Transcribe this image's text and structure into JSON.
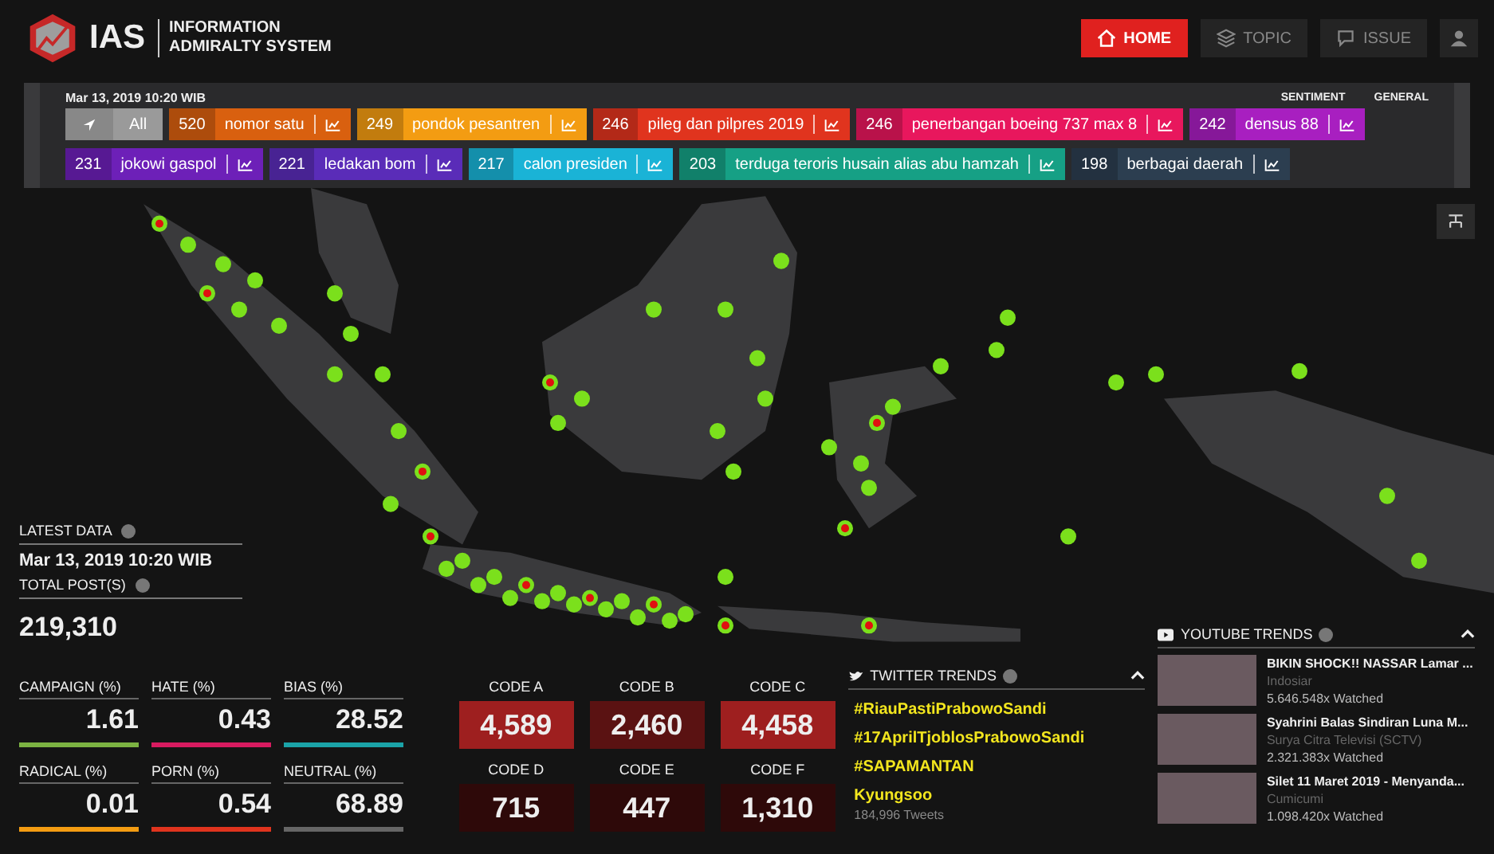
{
  "brand": {
    "short": "IAS",
    "line1": "INFORMATION",
    "line2": "ADMIRALTY SYSTEM"
  },
  "nav": [
    {
      "label": "HOME",
      "kind": "home",
      "selected": true
    },
    {
      "label": "TOPIC",
      "kind": "topic",
      "selected": false
    },
    {
      "label": "ISSUE",
      "kind": "issue",
      "selected": false
    },
    {
      "kind": "user",
      "selected": false
    }
  ],
  "filter_bar": {
    "date": "Mar 13, 2019 10:20 WIB",
    "sentiment": "SENTIMENT",
    "general": "GENERAL",
    "all": "All",
    "topics": [
      {
        "count": "520",
        "label": "nomor satu",
        "color": "#d9600f"
      },
      {
        "count": "249",
        "label": "pondok pesantren",
        "color": "#f39c12"
      },
      {
        "count": "246",
        "label": "pileg dan pilpres 2019",
        "color": "#e0341e"
      },
      {
        "count": "246",
        "label": "penerbangan boeing 737 max 8",
        "color": "#e8175d"
      },
      {
        "count": "242",
        "label": "densus 88",
        "color": "#a81fc0"
      },
      {
        "count": "231",
        "label": "jokowi gaspol",
        "color": "#6d20b8"
      },
      {
        "count": "221",
        "label": "ledakan bom",
        "color": "#5a2cb8"
      },
      {
        "count": "217",
        "label": "calon presiden",
        "color": "#1ab3d6"
      },
      {
        "count": "203",
        "label": "terduga teroris husain alias abu hamzah",
        "color": "#16a085"
      },
      {
        "count": "198",
        "label": "berbagai daerah",
        "color": "#2c3e50"
      }
    ]
  },
  "summary": {
    "latest_label": "LATEST DATA",
    "latest_value": "Mar 13, 2019 10:20 WIB",
    "total_label": "TOTAL POST(S)",
    "total_value": "219,310"
  },
  "metrics": [
    {
      "label": "CAMPAIGN (%)",
      "value": "1.61",
      "color": "#7cb342"
    },
    {
      "label": "HATE (%)",
      "value": "0.43",
      "color": "#d81b60"
    },
    {
      "label": "BIAS (%)",
      "value": "28.52",
      "color": "#1ba3a8"
    },
    {
      "label": "RADICAL (%)",
      "value": "0.01",
      "color": "#f39c12"
    },
    {
      "label": "PORN (%)",
      "value": "0.54",
      "color": "#e0341e"
    },
    {
      "label": "NEUTRAL (%)",
      "value": "68.89",
      "color": "#666666"
    }
  ],
  "codes": [
    {
      "label": "CODE A",
      "value": "4,589",
      "color": "#9e1f1f"
    },
    {
      "label": "CODE B",
      "value": "2,460",
      "color": "#5a1212"
    },
    {
      "label": "CODE C",
      "value": "4,458",
      "color": "#9e1f1f"
    },
    {
      "label": "CODE D",
      "value": "715",
      "color": "#2e0909"
    },
    {
      "label": "CODE E",
      "value": "447",
      "color": "#2e0909"
    },
    {
      "label": "CODE F",
      "value": "1,310",
      "color": "#2e0909"
    }
  ],
  "twitter": {
    "title": "TWITTER TRENDS",
    "trends": [
      {
        "tag": "#RiauPastiPrabowoSandi"
      },
      {
        "tag": "#17AprilTjoblosPrabowoSandi"
      },
      {
        "tag": "#SAPAMANTAN"
      },
      {
        "tag": "Kyungsoo",
        "count": "184,996 Tweets"
      }
    ]
  },
  "youtube": {
    "title": "YOUTUBE TRENDS",
    "videos": [
      {
        "title": "BIKIN SHOCK!! NASSAR Lamar ...",
        "channel": "Indosiar",
        "views": "5.646.548x Watched"
      },
      {
        "title": "Syahrini Balas Sindiran Luna M...",
        "channel": "Surya Citra Televisi (SCTV)",
        "views": "2.321.383x Watched"
      },
      {
        "title": "Silet 11 Maret 2019 - Menyanda...",
        "channel": "Cumicumi",
        "views": "1.098.420x Watched"
      }
    ]
  }
}
